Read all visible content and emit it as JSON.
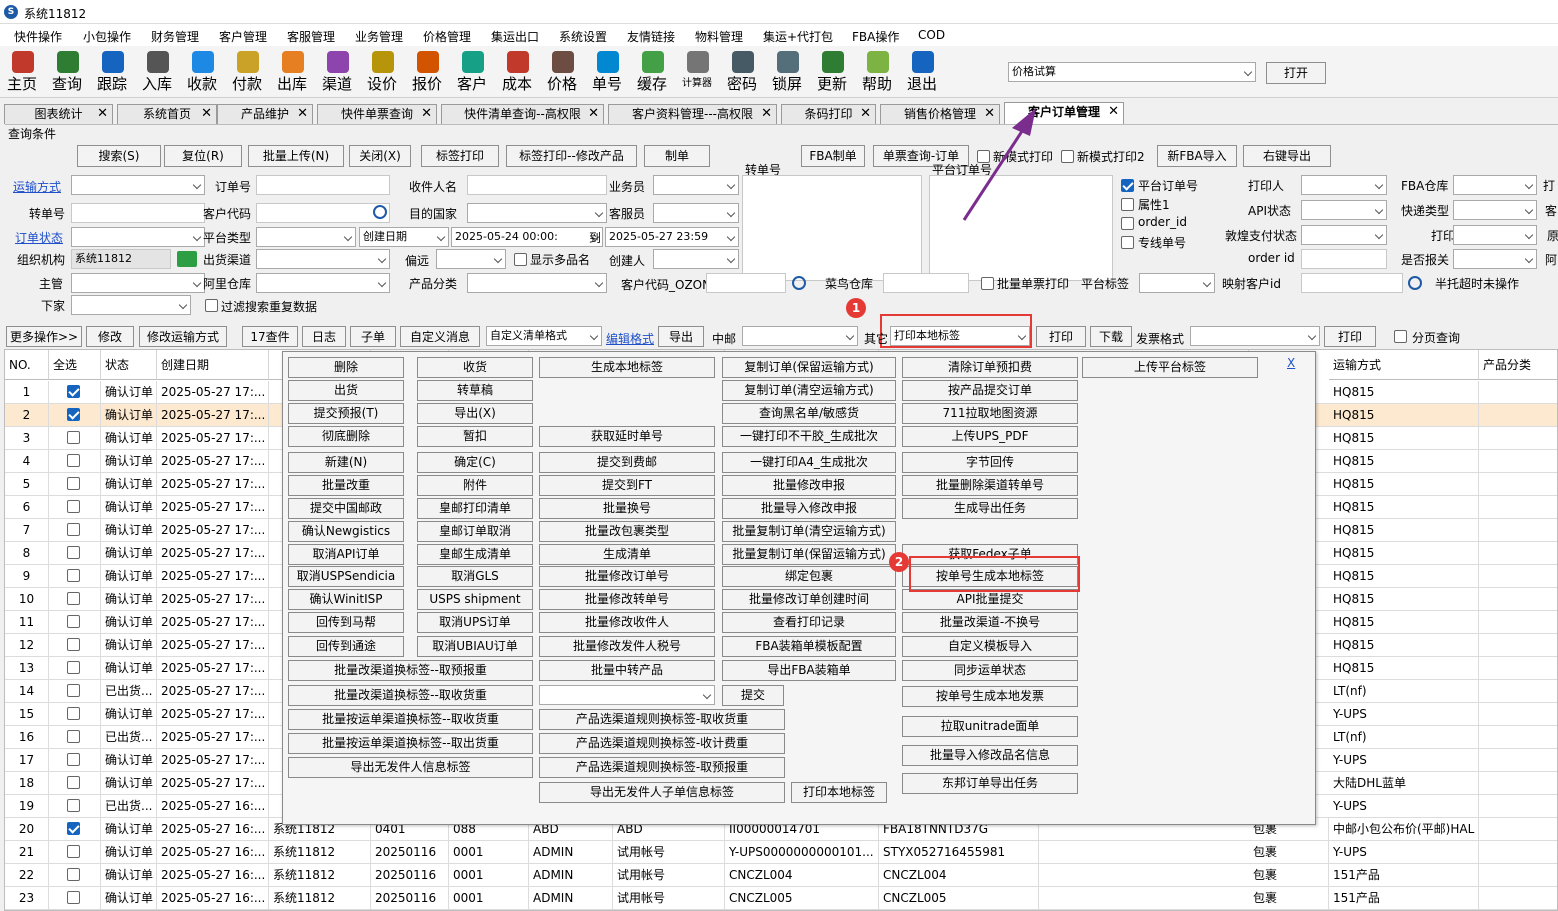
{
  "window": {
    "title": "系统11812",
    "logo": "S"
  },
  "menu": [
    "快件操作",
    "小包操作",
    "财务管理",
    "客户管理",
    "客服管理",
    "业务管理",
    "价格管理",
    "集运出口",
    "系统设置",
    "友情链接",
    "物料管理",
    "集运+代打包",
    "FBA操作",
    "COD"
  ],
  "toolbar": [
    {
      "label": "主页",
      "icon": "home-icon",
      "color": "#c0392b"
    },
    {
      "label": "查询",
      "icon": "search-icon",
      "color": "#2e7d32"
    },
    {
      "label": "跟踪",
      "icon": "wifi-icon",
      "color": "#1565c0"
    },
    {
      "label": "入库",
      "icon": "hammer-icon",
      "color": "#555555"
    },
    {
      "label": "收款",
      "icon": "yen-icon",
      "color": "#1e88e5"
    },
    {
      "label": "付款",
      "icon": "coins-icon",
      "color": "#c9a227"
    },
    {
      "label": "出库",
      "icon": "box-icon",
      "color": "#e67e22"
    },
    {
      "label": "渠道",
      "icon": "channel-icon",
      "color": "#8e44ad"
    },
    {
      "label": "设价",
      "icon": "scale-icon",
      "color": "#b7950b"
    },
    {
      "label": "报价",
      "icon": "quote-icon",
      "color": "#d35400"
    },
    {
      "label": "客户",
      "icon": "customer-icon",
      "color": "#16a085"
    },
    {
      "label": "成本",
      "icon": "chart-icon",
      "color": "#c0392b"
    },
    {
      "label": "价格",
      "icon": "price-icon",
      "color": "#6d4c41"
    },
    {
      "label": "单号",
      "icon": "eye-icon",
      "color": "#0288d1"
    },
    {
      "label": "缓存",
      "icon": "refresh-icon",
      "color": "#43a047"
    },
    {
      "label": "计算器",
      "icon": "calculator-icon",
      "color": "#757575"
    },
    {
      "label": "密码",
      "icon": "password-icon",
      "color": "#455a64"
    },
    {
      "label": "锁屏",
      "icon": "lock-icon",
      "color": "#546e7a"
    },
    {
      "label": "更新",
      "icon": "download-icon",
      "color": "#2e7d32"
    },
    {
      "label": "帮助",
      "icon": "help-icon",
      "color": "#7cb342"
    },
    {
      "label": "退出",
      "icon": "power-icon",
      "color": "#1565c0"
    }
  ],
  "price_combo": {
    "value": "价格试算",
    "open_label": "打开"
  },
  "tabs": [
    "图表统计",
    "系统首页",
    "产品维护",
    "快件单票查询",
    "快件清单查询--高权限",
    "客户资料管理---高权限",
    "条码打印",
    "销售价格管理",
    "客户订单管理"
  ],
  "query": {
    "section_label": "查询条件",
    "buttons": [
      "搜索(S)",
      "复位(R)",
      "批量上传(N)",
      "关闭(X)",
      "标签打印",
      "标签打印--修改产品",
      "制单"
    ],
    "buttons_right": [
      "FBA制单",
      "单票查询-订单",
      "新模式打印",
      "新模式打印2",
      "新FBA导入",
      "右键导出"
    ],
    "labels": {
      "transport": "运输方式",
      "order_no": "订单号",
      "recipient": "收件人名",
      "salesman": "业务员",
      "track_no": "转单号",
      "cust_code": "客户代码",
      "dest_country": "目的国家",
      "cs": "客服员",
      "order_status": "订单状态",
      "platform_type": "平台类型",
      "create_date": "创建日期",
      "to": "到",
      "org": "组织机构",
      "out_channel": "出货渠道",
      "remote": "偏远",
      "multi_name": "显示多品名",
      "creator": "创建人",
      "manager": "主管",
      "ali_wh": "阿里仓库",
      "prod_cat": "产品分类",
      "cust_ozon": "客户代码_OZON",
      "cainiao": "菜鸟仓库",
      "batch_print": "批量单票打印",
      "platform_tag": "平台标签",
      "map_cust": "映射客户id",
      "half_timeout": "半托超时未操作",
      "lower": "下家",
      "filter_dup": "过滤搜索重复数据",
      "track_area": "转单号",
      "platform_area": "平台订单号"
    },
    "org_value": "系统11812",
    "date_from": "2025-05-24 00:00:",
    "date_to": "2025-05-27 23:59",
    "check_options": [
      {
        "label": "平台订单号",
        "checked": true
      },
      {
        "label": "属性1",
        "checked": false
      },
      {
        "label": "order_id",
        "checked": false
      },
      {
        "label": "专线单号",
        "checked": false
      }
    ],
    "right_labels": [
      "打印人",
      "FBA仓库",
      "打",
      "API状态",
      "快递类型",
      "客",
      "敦煌支付状态",
      "打印",
      "原",
      "order id",
      "是否报关",
      "阿"
    ]
  },
  "actionbar": {
    "buttons": [
      "更多操作>>",
      "修改",
      "修改运输方式",
      "17查件",
      "日志",
      "子单",
      "自定义消息"
    ],
    "custom_fmt": "自定义清单格式",
    "edit_fmt": "编辑格式",
    "export": "导出",
    "zhongyou": "中邮",
    "other": "其它",
    "print_local": "打印本地标签",
    "print": "打印",
    "download": "下载",
    "invoice_fmt": "发票格式",
    "print2": "打印",
    "page_query": "分页查询"
  },
  "annotations": {
    "badge1": "1",
    "badge2": "2"
  },
  "popup": {
    "close": "X",
    "col1": [
      "删除",
      "出货",
      "提交预报(T)",
      "彻底删除",
      "新建(N)",
      "批量改重",
      "提交中国邮政",
      "确认Newgistics",
      "取消API订单",
      "取消USPSendicia",
      "确认WinitISP",
      "回传到马帮",
      "回传到通途"
    ],
    "col2": [
      "收货",
      "转草稿",
      "导出(X)",
      "暂扣",
      "确定(C)",
      "附件",
      "皇邮打印清单",
      "皇邮订单取消",
      "皇邮生成清单",
      "取消GLS",
      "USPS shipment",
      "取消UPS订单",
      "取消UBIAU订单"
    ],
    "col3": [
      "生成本地标签",
      "获取延时单号",
      "提交到费邮",
      "提交到FT",
      "批量换号",
      "批量改包裹类型",
      "生成清单",
      "批量修改订单号",
      "批量修改转单号",
      "批量修改收件人",
      "批量修改发件人税号",
      "批量中转产品"
    ],
    "col4": [
      "复制订单(保留运输方式)",
      "复制订单(清空运输方式)",
      "查询黑名单/敏感货",
      "一键打印不干胶_生成批次",
      "一键打印A4_生成批次",
      "批量修改申报",
      "批量导入修改申报",
      "批量复制订单(清空运输方式)",
      "批量复制订单(保留运输方式)",
      "绑定包裹",
      "批量修改订单创建时间",
      "查看打印记录",
      "FBA装箱单模板配置",
      "导出FBA装箱单"
    ],
    "col5": [
      "清除订单预扣费",
      "按产品提交订单",
      "711拉取地图资源",
      "上传UPS_PDF",
      "字节回传",
      "批量删除渠道转单号",
      "生成导出任务",
      "获取Fedex子单",
      "按单号生成本地标签",
      "API批量提交",
      "批量改渠道-不换号",
      "自定义模板导入",
      "同步运单状态",
      "按单号生成本地发票",
      "拉取unitrade面单",
      "批量导入修改品名信息",
      "东邦订单导出任务"
    ],
    "col6": [
      "上传平台标签"
    ],
    "wide_left": [
      "批量改渠道换标签--取预报重",
      "批量改渠道换标签--取收货重",
      "批量按运单渠道换标签--取收货重",
      "批量按运单渠道换标签--取出货重",
      "导出无发件人信息标签"
    ],
    "wide_mid": [
      "产品选渠道规则换标签-取收货重",
      "产品选渠道规则换标签-收计费重",
      "产品选渠道规则换标签-取预报重",
      "导出无发件人子单信息标签"
    ],
    "submit": "提交",
    "print_local": "打印本地标签"
  },
  "grid": {
    "headers": [
      "NO.",
      "全选",
      "状态",
      "创建日期",
      "",
      "",
      "",
      "",
      "",
      "",
      "运输方式",
      "产品分类"
    ],
    "rows": [
      {
        "no": "1",
        "chk": true,
        "status": "确认订单",
        "date": "2025-05-27 17:...",
        "ship": "HQ815"
      },
      {
        "no": "2",
        "chk": true,
        "status": "确认订单",
        "date": "2025-05-27 17:...",
        "ship": "HQ815",
        "sel": true
      },
      {
        "no": "3",
        "chk": false,
        "status": "确认订单",
        "date": "2025-05-27 17:...",
        "ship": "HQ815"
      },
      {
        "no": "4",
        "chk": false,
        "status": "确认订单",
        "date": "2025-05-27 17:...",
        "ship": "HQ815"
      },
      {
        "no": "5",
        "chk": false,
        "status": "确认订单",
        "date": "2025-05-27 17:...",
        "ship": "HQ815"
      },
      {
        "no": "6",
        "chk": false,
        "status": "确认订单",
        "date": "2025-05-27 17:...",
        "ship": "HQ815"
      },
      {
        "no": "7",
        "chk": false,
        "status": "确认订单",
        "date": "2025-05-27 17:...",
        "ship": "HQ815"
      },
      {
        "no": "8",
        "chk": false,
        "status": "确认订单",
        "date": "2025-05-27 17:...",
        "ship": "HQ815"
      },
      {
        "no": "9",
        "chk": false,
        "status": "确认订单",
        "date": "2025-05-27 17:...",
        "ship": "HQ815"
      },
      {
        "no": "10",
        "chk": false,
        "status": "确认订单",
        "date": "2025-05-27 17:...",
        "ship": "HQ815"
      },
      {
        "no": "11",
        "chk": false,
        "status": "确认订单",
        "date": "2025-05-27 17:...",
        "ship": "HQ815"
      },
      {
        "no": "12",
        "chk": false,
        "status": "确认订单",
        "date": "2025-05-27 17:...",
        "ship": "HQ815"
      },
      {
        "no": "13",
        "chk": false,
        "status": "确认订单",
        "date": "2025-05-27 17:...",
        "ship": "HQ815"
      },
      {
        "no": "14",
        "chk": false,
        "status": "已出货...",
        "date": "2025-05-27 17:...",
        "ship": "LT(nf)"
      },
      {
        "no": "15",
        "chk": false,
        "status": "确认订单",
        "date": "2025-05-27 17:...",
        "ship": "Y-UPS"
      },
      {
        "no": "16",
        "chk": false,
        "status": "已出货...",
        "date": "2025-05-27 17:...",
        "ship": "LT(nf)"
      },
      {
        "no": "17",
        "chk": false,
        "status": "确认订单",
        "date": "2025-05-27 17:...",
        "ship": "Y-UPS"
      },
      {
        "no": "18",
        "chk": false,
        "status": "确认订单",
        "date": "2025-05-27 17:...",
        "ship": "大陆DHL蓝单"
      },
      {
        "no": "19",
        "chk": false,
        "status": "已出货...",
        "date": "2025-05-27 16:...",
        "ship": "Y-UPS"
      },
      {
        "no": "20",
        "chk": true,
        "status": "确认订单",
        "date": "2025-05-27 16:...",
        "org": "系统11812",
        "c1": "0401",
        "c2": "088",
        "c3": "ABD",
        "c4": "ABD",
        "c5": "II00000014701",
        "c6": "FBA18TNNTD37G",
        "c7": "包裹",
        "ship": "中邮小包公布价(平邮)HAL"
      },
      {
        "no": "21",
        "chk": false,
        "status": "确认订单",
        "date": "2025-05-27 16:...",
        "org": "系统11812",
        "c1": "20250116",
        "c2": "0001",
        "c3": "ADMIN",
        "c4": "试用帐号",
        "c5": "Y-UPS0000000000101...",
        "c6": "STYX052716455981",
        "c7": "包裹",
        "ship": "Y-UPS"
      },
      {
        "no": "22",
        "chk": false,
        "status": "确认订单",
        "date": "2025-05-27 16:...",
        "org": "系统11812",
        "c1": "20250116",
        "c2": "0001",
        "c3": "ADMIN",
        "c4": "试用帐号",
        "c5": "CNCZL004",
        "c6": "CNCZL004",
        "c7": "包裹",
        "ship": "151产品"
      },
      {
        "no": "23",
        "chk": false,
        "status": "确认订单",
        "date": "2025-05-27 16:...",
        "org": "系统11812",
        "c1": "20250116",
        "c2": "0001",
        "c3": "ADMIN",
        "c4": "试用帐号",
        "c5": "CNCZL005",
        "c6": "CNCZL005",
        "c7": "包裹",
        "ship": "151产品"
      }
    ]
  }
}
